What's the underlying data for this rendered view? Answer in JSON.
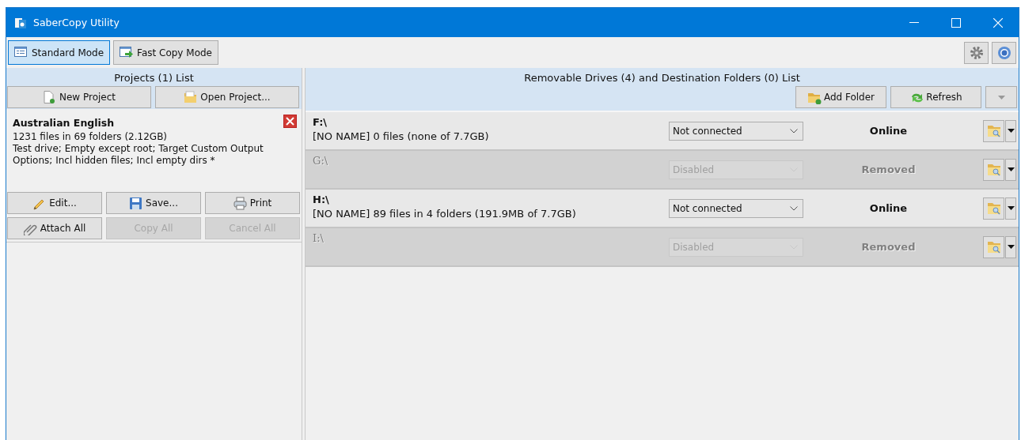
{
  "window": {
    "title": "SaberCopy Utility"
  },
  "modes": [
    {
      "label": "Standard Mode",
      "selected": true,
      "kind": "standard"
    },
    {
      "label": "Fast Copy Mode",
      "selected": false,
      "kind": "fast"
    }
  ],
  "projects_panel": {
    "title": "Projects (1) List",
    "buttons": [
      {
        "label": "New Project",
        "kind": "new"
      },
      {
        "label": "Open Project...",
        "kind": "open"
      }
    ],
    "projects": [
      {
        "name": "Australian English",
        "summary": "1231 files in 69 folders (2.12GB)",
        "options": "Test drive; Empty except root; Target Custom Output Options; Incl hidden files; Incl empty dirs *"
      }
    ],
    "actions": [
      {
        "label": "Edit...",
        "kind": "edit",
        "disabled": false
      },
      {
        "label": "Save...",
        "kind": "save",
        "disabled": false
      },
      {
        "label": "Print",
        "kind": "print",
        "disabled": false
      },
      {
        "label": "Attach All",
        "kind": "attach",
        "disabled": false
      },
      {
        "label": "Copy All",
        "kind": "none",
        "disabled": true
      },
      {
        "label": "Cancel All",
        "kind": "none",
        "disabled": true
      }
    ]
  },
  "drives_panel": {
    "title": "Removable Drives (4) and Destination Folders (0) List",
    "buttons": [
      {
        "label": "Add Folder",
        "kind": "add"
      },
      {
        "label": "Refresh",
        "kind": "refresh"
      }
    ],
    "drives": [
      {
        "path": "F:\\",
        "description": "[NO NAME] 0 files (none of 7.7GB)",
        "mode": "Not connected",
        "status": "Online",
        "disabled": false
      },
      {
        "path": "G:\\",
        "mode": "Disabled",
        "status": "Removed",
        "disabled": true
      },
      {
        "path": "H:\\",
        "description": "[NO NAME] 89 files in 4 folders (191.9MB of 7.7GB)",
        "mode": "Not connected",
        "status": "Online",
        "disabled": false
      },
      {
        "path": "I:\\",
        "mode": "Disabled",
        "status": "Removed",
        "disabled": true
      }
    ]
  }
}
